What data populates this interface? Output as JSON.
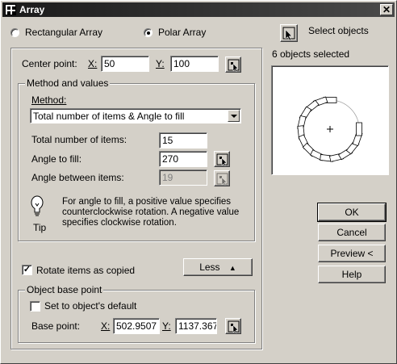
{
  "window": {
    "title": "Array",
    "close_glyph": "✕"
  },
  "array_type": {
    "rectangular_label": "Rectangular Array",
    "polar_label": "Polar Array",
    "selected": "polar"
  },
  "center_point": {
    "label": "Center point:",
    "x_label": "X:",
    "x_value": "50",
    "y_label": "Y:",
    "y_value": "100"
  },
  "method_group": {
    "title": "Method and values",
    "method_label": "Method:",
    "method_value": "Total number of items & Angle to fill",
    "total_items_label": "Total number of items:",
    "total_items_value": "15",
    "angle_fill_label": "Angle to fill:",
    "angle_fill_value": "270",
    "angle_between_label": "Angle between items:",
    "angle_between_value": "19",
    "tip_text": "For angle to fill, a positive value specifies counterclockwise rotation.  A negative value specifies clockwise rotation.",
    "tip_label": "Tip"
  },
  "rotate": {
    "label": "Rotate items as copied",
    "checked": true
  },
  "less_button": {
    "label": "Less",
    "icon": "double-up-arrow"
  },
  "base_point_group": {
    "title": "Object base point",
    "default_label": "Set to object's default",
    "default_checked": false,
    "base_point_label": "Base point:",
    "x_label": "X:",
    "x_value": "502.9507",
    "y_label": "Y:",
    "y_value": "1137.367"
  },
  "select_objects": {
    "label": "Select objects",
    "status": "6 objects selected"
  },
  "preview_image": {
    "item_count": 15,
    "angle_fill": 270
  },
  "buttons": {
    "ok": "OK",
    "cancel": "Cancel",
    "preview": "Preview <",
    "help": "Help"
  },
  "colors": {
    "dialog_bg": "#d4d0c8",
    "titlebar": "#1a1a1a",
    "field_bg": "#ffffff"
  }
}
